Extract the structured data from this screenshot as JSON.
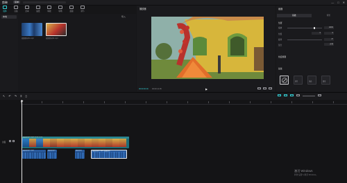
{
  "titlebar": {
    "app": "剪映",
    "menu": "菜单",
    "controls": [
      "—",
      "□",
      "✕"
    ]
  },
  "media_toolbar": [
    {
      "label": "媒体",
      "icon": "media-icon",
      "active": true
    },
    {
      "label": "音频",
      "icon": "audio-icon"
    },
    {
      "label": "文本",
      "icon": "text-icon"
    },
    {
      "label": "贴纸",
      "icon": "sticker-icon"
    },
    {
      "label": "特效",
      "icon": "effects-icon"
    },
    {
      "label": "转场",
      "icon": "transition-icon"
    },
    {
      "label": "滤镜",
      "icon": "filter-icon"
    },
    {
      "label": "调节",
      "icon": "adjust-icon"
    }
  ],
  "left_nav": {
    "item": "本地"
  },
  "media_panel": {
    "import": "导入",
    "clips": [
      {
        "label": "视频素材01.mp4"
      },
      {
        "label": "视频素材02.mp4"
      }
    ]
  },
  "player": {
    "title": "播放器",
    "time_current": "00:00:00:00",
    "time_total": "00:00:12:05",
    "play_icon": "▶"
  },
  "right_panel": {
    "title": "画面",
    "tabs": [
      "基础",
      "背景"
    ],
    "section1": "位置",
    "fields": [
      {
        "label": "缩放",
        "value": "100%"
      },
      {
        "label": "位置",
        "value": "0"
      },
      {
        "label": "旋转",
        "value": "0°"
      },
      {
        "label": "混合",
        "value": "正常"
      }
    ],
    "section2": "色度抠图",
    "section3": "蒙版",
    "mask_options": [
      "无",
      "线性",
      "镜面",
      "圆形"
    ]
  },
  "timeline": {
    "track_label": "封面",
    "main_clip": "视频素材02.mp4  00:00:12:05",
    "audio_clips": [
      {
        "label": "视频素材01.mp4"
      },
      {
        "label": "视频素材01"
      },
      {
        "label": "视频素材"
      },
      {
        "label": "视频素材01.mp4  视频素材"
      }
    ]
  },
  "watermark": {
    "line1": "激活 Windows",
    "line2": "转到\"设置\"以激活 Windows。"
  }
}
